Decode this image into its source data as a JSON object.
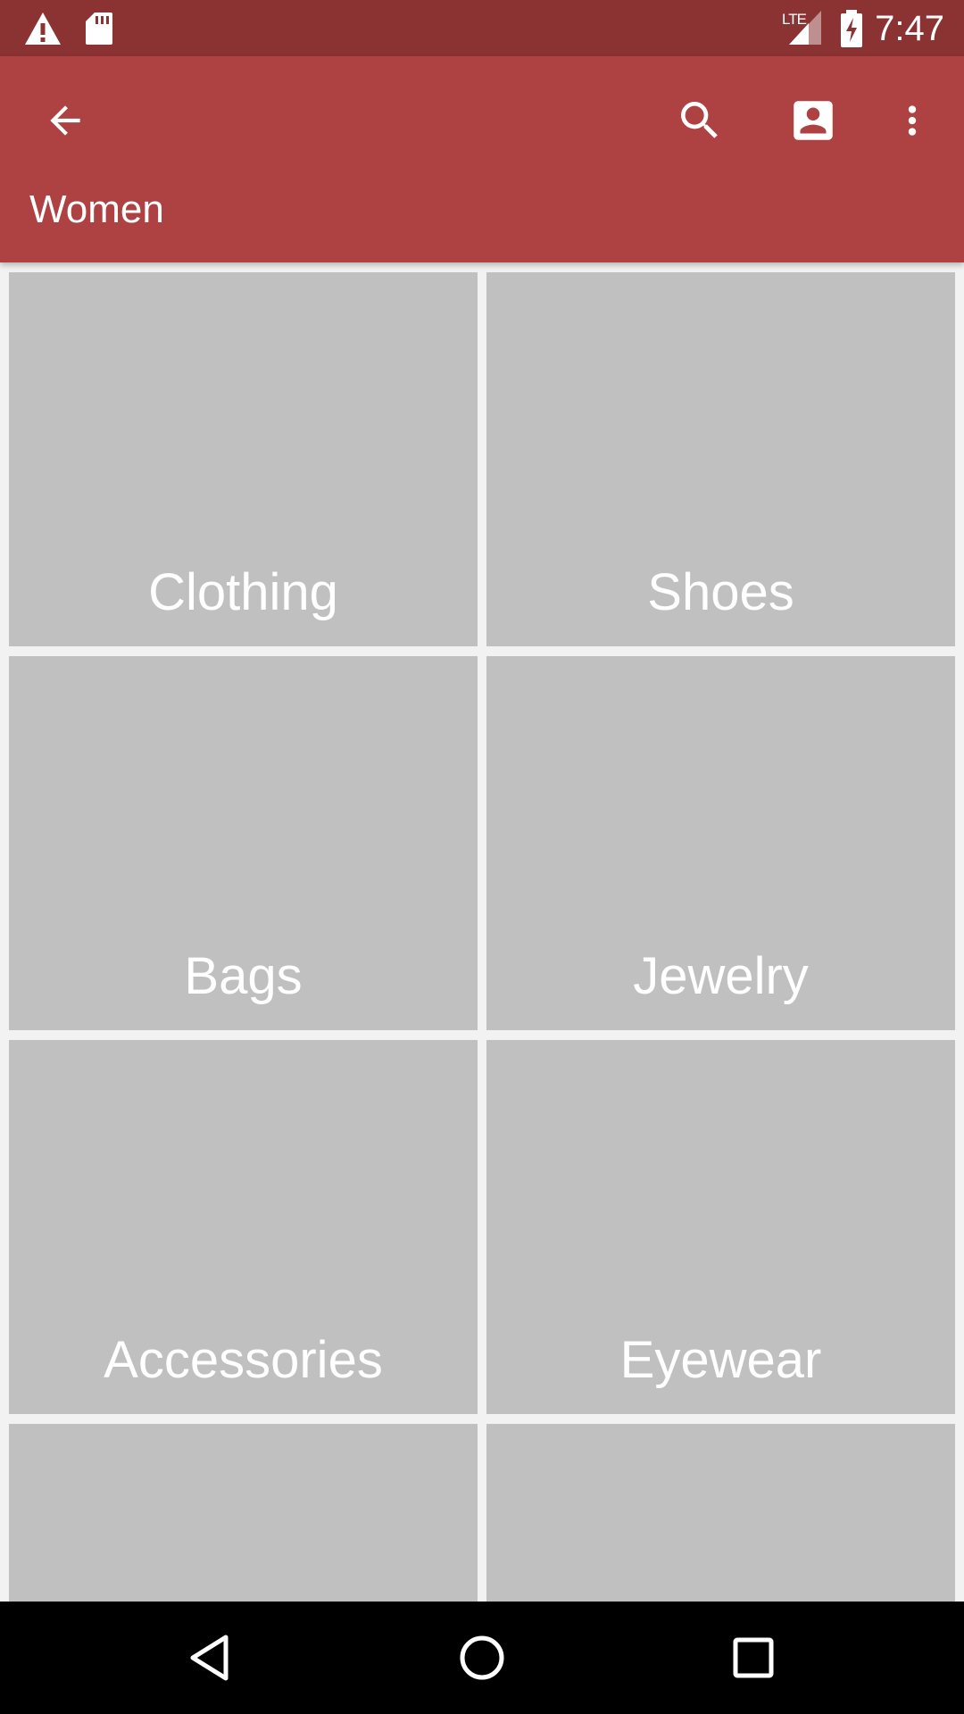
{
  "status_bar": {
    "time": "7:47",
    "network_label": "LTE",
    "icons": [
      "warning-icon",
      "sd-card-icon",
      "lte-signal-icon",
      "battery-charging-icon"
    ]
  },
  "toolbar": {
    "title": "Women",
    "icons": [
      "arrow-back-icon",
      "search-icon",
      "account-box-icon",
      "more-vert-icon"
    ],
    "background": "#ae4243"
  },
  "colors": {
    "status_bar": "#8b3233",
    "toolbar": "#ae4243",
    "tile": "#c0c0c0",
    "background": "#f2f2f2",
    "nav_bar": "#000000"
  },
  "categories": [
    {
      "label": "Clothing"
    },
    {
      "label": "Shoes"
    },
    {
      "label": "Bags"
    },
    {
      "label": "Jewelry"
    },
    {
      "label": "Accessories"
    },
    {
      "label": "Eyewear"
    },
    {
      "label": ""
    },
    {
      "label": ""
    }
  ],
  "nav_bar": {
    "icons": [
      "nav-back-icon",
      "nav-home-icon",
      "nav-recents-icon"
    ]
  }
}
